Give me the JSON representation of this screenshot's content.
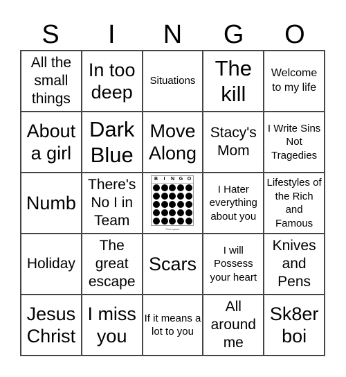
{
  "header": {
    "letters": [
      "S",
      "I",
      "N",
      "G",
      "O"
    ]
  },
  "cells": [
    "All the small things",
    "In too deep",
    "Situations",
    "The kill",
    "Welcome to my life",
    "About a girl",
    "Dark Blue",
    "Move Along",
    "Stacy's Mom",
    "I Write Sins Not Tragedies",
    "Numb",
    "There's No I in Team",
    "",
    "I Hater everything about you",
    "Lifestyles of the Rich and Famous",
    "Holiday",
    "The great escape",
    "Scars",
    "I will Possess your heart",
    "Knives and Pens",
    "Jesus Christ",
    "I miss you",
    "If it means a lot to you",
    "All around me",
    "Sk8er boi"
  ],
  "free_space": {
    "letters": [
      "B",
      "I",
      "N",
      "G",
      "O"
    ],
    "caption": "Free space"
  }
}
